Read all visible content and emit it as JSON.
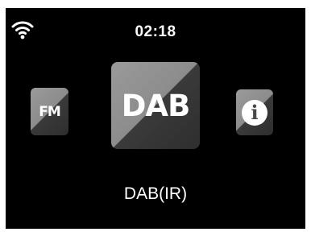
{
  "status_bar": {
    "wifi_icon": "wifi-icon",
    "time": "02:18"
  },
  "modes": [
    {
      "label": "FM",
      "icon": "fm-tile",
      "selected": false
    },
    {
      "label": "DAB",
      "icon": "dab-tile",
      "selected": true
    },
    {
      "label": "i",
      "icon": "info-icon",
      "selected": false
    }
  ],
  "selected_mode_label": "DAB(IR)",
  "colors": {
    "background": "#000000",
    "text": "#ffffff",
    "tile_light": "#8c8c8c",
    "tile_dark": "#2e2e2e"
  }
}
